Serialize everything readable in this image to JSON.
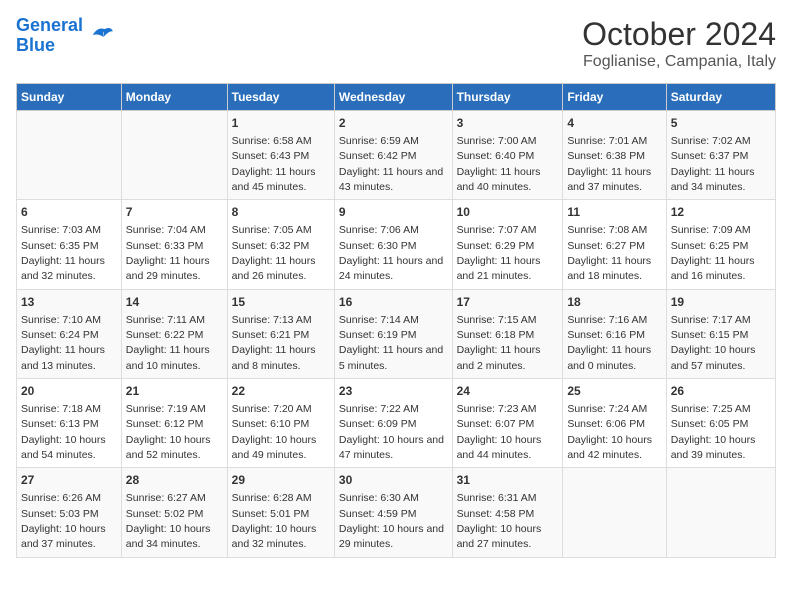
{
  "header": {
    "logo_line1": "General",
    "logo_line2": "Blue",
    "title": "October 2024",
    "subtitle": "Foglianise, Campania, Italy"
  },
  "columns": [
    "Sunday",
    "Monday",
    "Tuesday",
    "Wednesday",
    "Thursday",
    "Friday",
    "Saturday"
  ],
  "weeks": [
    [
      {
        "day": "",
        "sunrise": "",
        "sunset": "",
        "daylight": ""
      },
      {
        "day": "",
        "sunrise": "",
        "sunset": "",
        "daylight": ""
      },
      {
        "day": "1",
        "sunrise": "Sunrise: 6:58 AM",
        "sunset": "Sunset: 6:43 PM",
        "daylight": "Daylight: 11 hours and 45 minutes."
      },
      {
        "day": "2",
        "sunrise": "Sunrise: 6:59 AM",
        "sunset": "Sunset: 6:42 PM",
        "daylight": "Daylight: 11 hours and 43 minutes."
      },
      {
        "day": "3",
        "sunrise": "Sunrise: 7:00 AM",
        "sunset": "Sunset: 6:40 PM",
        "daylight": "Daylight: 11 hours and 40 minutes."
      },
      {
        "day": "4",
        "sunrise": "Sunrise: 7:01 AM",
        "sunset": "Sunset: 6:38 PM",
        "daylight": "Daylight: 11 hours and 37 minutes."
      },
      {
        "day": "5",
        "sunrise": "Sunrise: 7:02 AM",
        "sunset": "Sunset: 6:37 PM",
        "daylight": "Daylight: 11 hours and 34 minutes."
      }
    ],
    [
      {
        "day": "6",
        "sunrise": "Sunrise: 7:03 AM",
        "sunset": "Sunset: 6:35 PM",
        "daylight": "Daylight: 11 hours and 32 minutes."
      },
      {
        "day": "7",
        "sunrise": "Sunrise: 7:04 AM",
        "sunset": "Sunset: 6:33 PM",
        "daylight": "Daylight: 11 hours and 29 minutes."
      },
      {
        "day": "8",
        "sunrise": "Sunrise: 7:05 AM",
        "sunset": "Sunset: 6:32 PM",
        "daylight": "Daylight: 11 hours and 26 minutes."
      },
      {
        "day": "9",
        "sunrise": "Sunrise: 7:06 AM",
        "sunset": "Sunset: 6:30 PM",
        "daylight": "Daylight: 11 hours and 24 minutes."
      },
      {
        "day": "10",
        "sunrise": "Sunrise: 7:07 AM",
        "sunset": "Sunset: 6:29 PM",
        "daylight": "Daylight: 11 hours and 21 minutes."
      },
      {
        "day": "11",
        "sunrise": "Sunrise: 7:08 AM",
        "sunset": "Sunset: 6:27 PM",
        "daylight": "Daylight: 11 hours and 18 minutes."
      },
      {
        "day": "12",
        "sunrise": "Sunrise: 7:09 AM",
        "sunset": "Sunset: 6:25 PM",
        "daylight": "Daylight: 11 hours and 16 minutes."
      }
    ],
    [
      {
        "day": "13",
        "sunrise": "Sunrise: 7:10 AM",
        "sunset": "Sunset: 6:24 PM",
        "daylight": "Daylight: 11 hours and 13 minutes."
      },
      {
        "day": "14",
        "sunrise": "Sunrise: 7:11 AM",
        "sunset": "Sunset: 6:22 PM",
        "daylight": "Daylight: 11 hours and 10 minutes."
      },
      {
        "day": "15",
        "sunrise": "Sunrise: 7:13 AM",
        "sunset": "Sunset: 6:21 PM",
        "daylight": "Daylight: 11 hours and 8 minutes."
      },
      {
        "day": "16",
        "sunrise": "Sunrise: 7:14 AM",
        "sunset": "Sunset: 6:19 PM",
        "daylight": "Daylight: 11 hours and 5 minutes."
      },
      {
        "day": "17",
        "sunrise": "Sunrise: 7:15 AM",
        "sunset": "Sunset: 6:18 PM",
        "daylight": "Daylight: 11 hours and 2 minutes."
      },
      {
        "day": "18",
        "sunrise": "Sunrise: 7:16 AM",
        "sunset": "Sunset: 6:16 PM",
        "daylight": "Daylight: 11 hours and 0 minutes."
      },
      {
        "day": "19",
        "sunrise": "Sunrise: 7:17 AM",
        "sunset": "Sunset: 6:15 PM",
        "daylight": "Daylight: 10 hours and 57 minutes."
      }
    ],
    [
      {
        "day": "20",
        "sunrise": "Sunrise: 7:18 AM",
        "sunset": "Sunset: 6:13 PM",
        "daylight": "Daylight: 10 hours and 54 minutes."
      },
      {
        "day": "21",
        "sunrise": "Sunrise: 7:19 AM",
        "sunset": "Sunset: 6:12 PM",
        "daylight": "Daylight: 10 hours and 52 minutes."
      },
      {
        "day": "22",
        "sunrise": "Sunrise: 7:20 AM",
        "sunset": "Sunset: 6:10 PM",
        "daylight": "Daylight: 10 hours and 49 minutes."
      },
      {
        "day": "23",
        "sunrise": "Sunrise: 7:22 AM",
        "sunset": "Sunset: 6:09 PM",
        "daylight": "Daylight: 10 hours and 47 minutes."
      },
      {
        "day": "24",
        "sunrise": "Sunrise: 7:23 AM",
        "sunset": "Sunset: 6:07 PM",
        "daylight": "Daylight: 10 hours and 44 minutes."
      },
      {
        "day": "25",
        "sunrise": "Sunrise: 7:24 AM",
        "sunset": "Sunset: 6:06 PM",
        "daylight": "Daylight: 10 hours and 42 minutes."
      },
      {
        "day": "26",
        "sunrise": "Sunrise: 7:25 AM",
        "sunset": "Sunset: 6:05 PM",
        "daylight": "Daylight: 10 hours and 39 minutes."
      }
    ],
    [
      {
        "day": "27",
        "sunrise": "Sunrise: 6:26 AM",
        "sunset": "Sunset: 5:03 PM",
        "daylight": "Daylight: 10 hours and 37 minutes."
      },
      {
        "day": "28",
        "sunrise": "Sunrise: 6:27 AM",
        "sunset": "Sunset: 5:02 PM",
        "daylight": "Daylight: 10 hours and 34 minutes."
      },
      {
        "day": "29",
        "sunrise": "Sunrise: 6:28 AM",
        "sunset": "Sunset: 5:01 PM",
        "daylight": "Daylight: 10 hours and 32 minutes."
      },
      {
        "day": "30",
        "sunrise": "Sunrise: 6:30 AM",
        "sunset": "Sunset: 4:59 PM",
        "daylight": "Daylight: 10 hours and 29 minutes."
      },
      {
        "day": "31",
        "sunrise": "Sunrise: 6:31 AM",
        "sunset": "Sunset: 4:58 PM",
        "daylight": "Daylight: 10 hours and 27 minutes."
      },
      {
        "day": "",
        "sunrise": "",
        "sunset": "",
        "daylight": ""
      },
      {
        "day": "",
        "sunrise": "",
        "sunset": "",
        "daylight": ""
      }
    ]
  ]
}
